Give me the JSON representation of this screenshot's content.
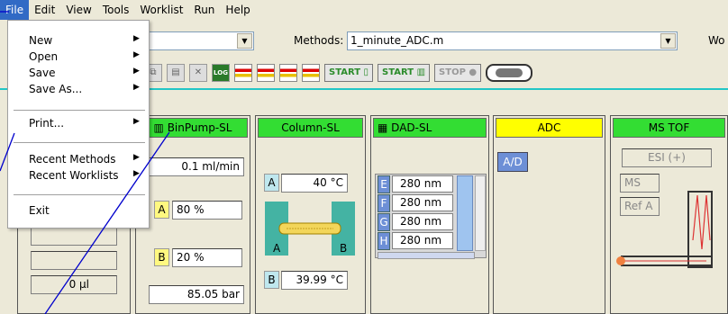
{
  "menubar": {
    "items": [
      "File",
      "Edit",
      "View",
      "Tools",
      "Worklist",
      "Run",
      "Help"
    ]
  },
  "file_menu": {
    "items": [
      {
        "label": "New",
        "submenu": true
      },
      {
        "label": "Open",
        "submenu": true
      },
      {
        "label": "Save",
        "submenu": true
      },
      {
        "label": "Save As...",
        "submenu": true
      },
      {
        "label": "Print...",
        "submenu": true
      },
      {
        "label": "Recent Methods",
        "submenu": true
      },
      {
        "label": "Recent Worklists",
        "submenu": true
      },
      {
        "label": "Exit",
        "submenu": false
      }
    ]
  },
  "methodbar": {
    "methods_label": "Methods:",
    "methods_value": "1_minute_ADC.m",
    "trailing_label": "Wo"
  },
  "toolbar": {
    "start_label": "START",
    "start_batch_label": "START",
    "stop_label": "STOP",
    "log_label": "LOG"
  },
  "left_panel": {
    "volume": "0 µl"
  },
  "binpump": {
    "title": "BinPump-SL",
    "flow": "0.1 ml/min",
    "solvent_a_label": "A",
    "solvent_a_pct": "80 %",
    "solvent_b_label": "B",
    "solvent_b_pct": "20 %",
    "pressure": "85.05 bar"
  },
  "column": {
    "title": "Column-SL",
    "a_label": "A",
    "a_temp": "40 °C",
    "b_label": "B",
    "b_temp": "39.99 °C",
    "diagram_a": "A",
    "diagram_b": "B"
  },
  "dad": {
    "title": "DAD-SL",
    "channels": [
      {
        "id": "E",
        "wl": "280 nm"
      },
      {
        "id": "F",
        "wl": "280 nm"
      },
      {
        "id": "G",
        "wl": "280 nm"
      },
      {
        "id": "H",
        "wl": "280 nm"
      }
    ]
  },
  "adc": {
    "title": "ADC",
    "ad_label": "A/D"
  },
  "mstof": {
    "title": "MS TOF",
    "source": "ESI (+)",
    "ms_label": "MS",
    "refa_label": "Ref A"
  },
  "colors": {
    "menu_highlight": "#316ac5",
    "module_header_ok": "#33dd33",
    "module_header_adc": "#ffff00",
    "annotation_line": "#0000cc"
  }
}
